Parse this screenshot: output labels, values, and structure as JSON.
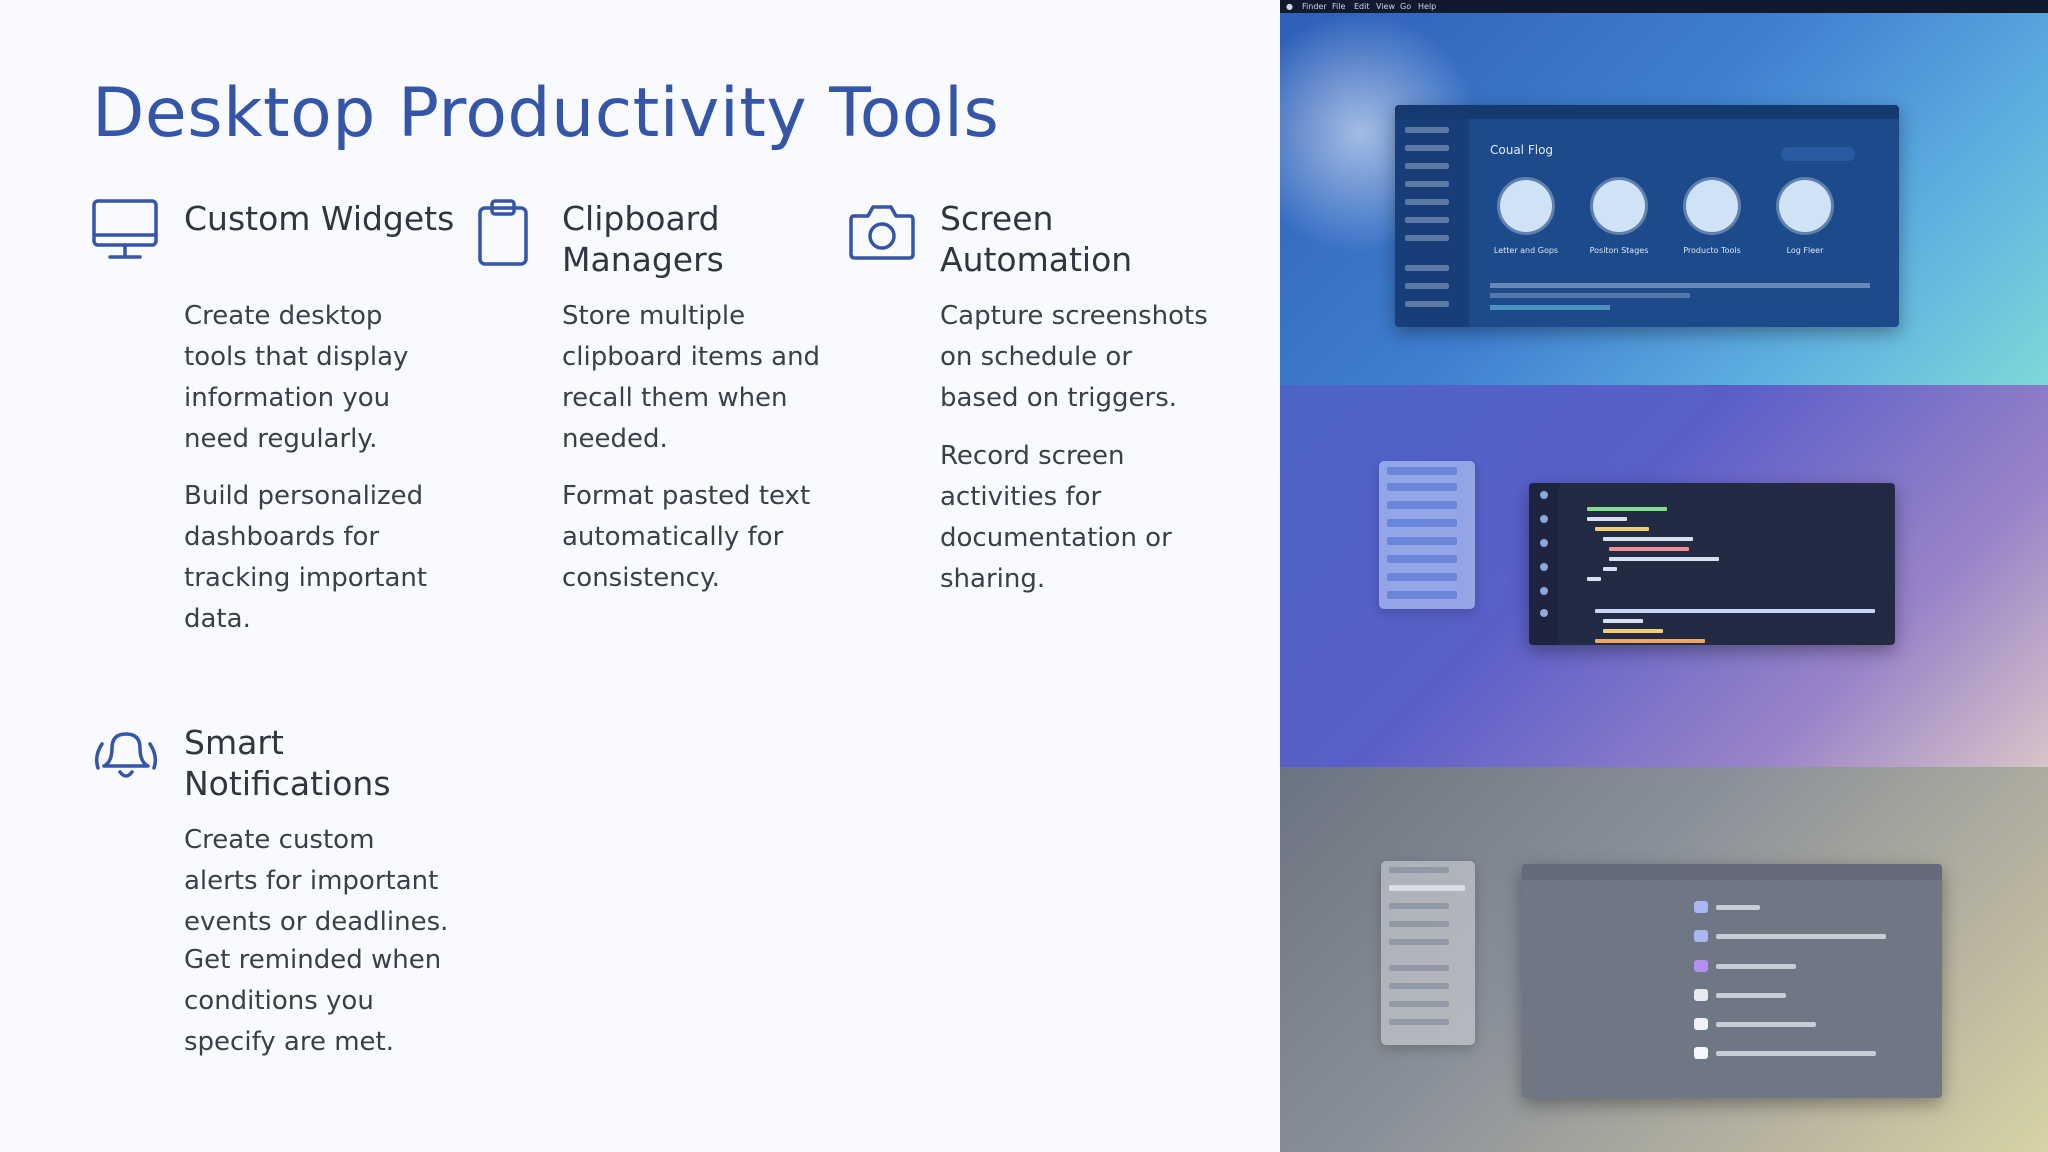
{
  "title": "Desktop Productivity Tools",
  "features": [
    {
      "icon": "monitor-icon",
      "heading": "Custom Widgets",
      "paragraphs": [
        "Create desktop tools that display information you need regularly.",
        "Build personalized dashboards for tracking important data."
      ]
    },
    {
      "icon": "clipboard-icon",
      "heading": "Clipboard Managers",
      "paragraphs": [
        "Store multiple clipboard items and recall them when needed.",
        "Format pasted text automatically for consistency."
      ]
    },
    {
      "icon": "camera-icon",
      "heading": "Screen Automation",
      "paragraphs": [
        "Capture screenshots on schedule or based on triggers.",
        "Record screen activities for documentation or sharing."
      ]
    },
    {
      "icon": "bell-icon",
      "heading": "Smart Notifications",
      "paragraphs": [
        "Create custom alerts for important events or deadlines.",
        "Get reminded when conditions you specify are met."
      ]
    }
  ],
  "illustration": {
    "menubar_items": [
      "Finder",
      "File",
      "Edit",
      "View",
      "Go",
      "Help"
    ],
    "window1_title": "Coual Flog",
    "window1_apps": [
      "Letter and Gops",
      "Positon Stages",
      "Producto Tools",
      "Log Fleer"
    ]
  }
}
